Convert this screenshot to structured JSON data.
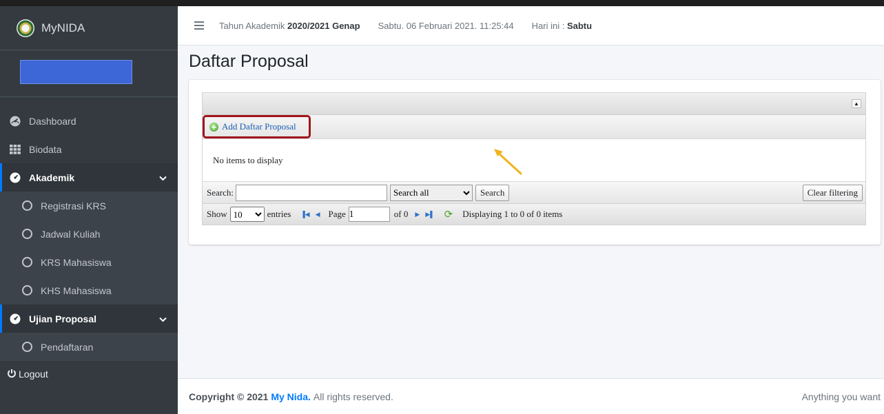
{
  "brand": {
    "name": "MyNIDA"
  },
  "sidebar": {
    "items": [
      {
        "label": "Dashboard",
        "icon": "tachometer-icon"
      },
      {
        "label": "Biodata",
        "icon": "grid-icon"
      }
    ],
    "akademik": {
      "label": "Akademik",
      "children": [
        "Registrasi KRS",
        "Jadwal Kuliah",
        "KRS Mahasiswa",
        "KHS Mahasiswa"
      ]
    },
    "ujian": {
      "label": "Ujian Proposal",
      "children": [
        "Pendaftaran"
      ]
    },
    "logout": "Logout"
  },
  "header": {
    "tahun_prefix": "Tahun Akademik",
    "tahun_value": "2020/2021 Genap",
    "datetime": "Sabtu. 06 Februari 2021. 11:25:44",
    "hari_prefix": "Hari ini :",
    "hari_value": "Sabtu"
  },
  "page": {
    "title": "Daftar Proposal"
  },
  "grid": {
    "add_label": "Add Daftar Proposal",
    "empty_text": "No items to display",
    "search_label": "Search:",
    "search_value": "",
    "search_scope": "Search all",
    "search_button": "Search",
    "clear_button": "Clear filtering",
    "show_label": "Show",
    "entries_value": "10",
    "entries_label": "entries",
    "page_label": "Page",
    "page_value": "1",
    "of_label": "of 0",
    "display_info": "Displaying 1 to 0 of 0 items"
  },
  "footer": {
    "copyright_prefix": "Copyright © 2021",
    "brand": "My Nida.",
    "rights": "All rights reserved.",
    "right_text": "Anything you want"
  },
  "colors": {
    "sidebar": "#343a40",
    "accent": "#007bff",
    "highlight": "#a0141b",
    "annotation": "#f0b41c"
  }
}
